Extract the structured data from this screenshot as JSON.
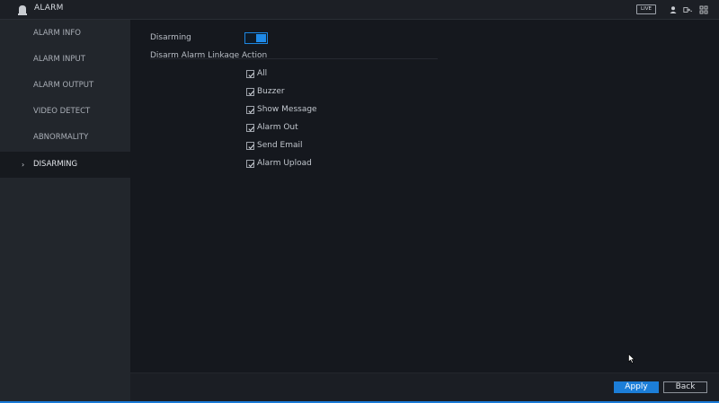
{
  "window": {
    "title": "ALARM",
    "live_label": "LIVE"
  },
  "sidebar": {
    "items": [
      {
        "label": "ALARM INFO",
        "active": false
      },
      {
        "label": "ALARM INPUT",
        "active": false
      },
      {
        "label": "ALARM OUTPUT",
        "active": false
      },
      {
        "label": "VIDEO DETECT",
        "active": false
      },
      {
        "label": "ABNORMALITY",
        "active": false
      },
      {
        "label": "DISARMING",
        "active": true
      }
    ]
  },
  "main": {
    "disarming_label": "Disarming",
    "disarming_enabled": true,
    "linkage_title": "Disarm Alarm Linkage Action",
    "options": [
      {
        "label": "All",
        "checked": true
      },
      {
        "label": "Buzzer",
        "checked": true
      },
      {
        "label": "Show Message",
        "checked": true
      },
      {
        "label": "Alarm Out",
        "checked": true
      },
      {
        "label": "Send Email",
        "checked": true
      },
      {
        "label": "Alarm Upload",
        "checked": true
      }
    ]
  },
  "footer": {
    "apply_label": "Apply",
    "back_label": "Back"
  },
  "colors": {
    "accent": "#1c7ed8",
    "background": "#15181e",
    "sidebar": "#22262c"
  }
}
